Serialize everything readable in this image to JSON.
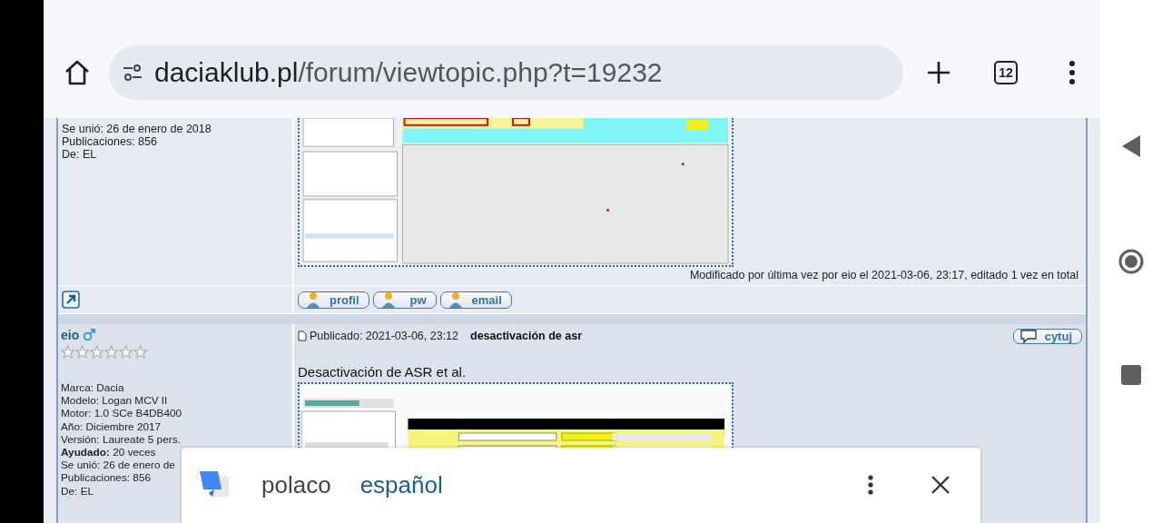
{
  "browser": {
    "url_host": "daciaklub.pl",
    "url_path": "/forum/viewtopic.php?t=19232",
    "tab_count": "12"
  },
  "posts": [
    {
      "profile_lines": [
        "Se unió: 26 de enero de 2018",
        "Publicaciones: 856",
        "De: EL"
      ],
      "edit_note": "Modificado por última vez por eio el 2021-03-06, 23:17, editado 1 vez en total",
      "buttons": [
        "profil",
        "pw",
        "email"
      ]
    },
    {
      "author": "eio",
      "stars": 0,
      "published": "Publicado: 2021-03-06, 23:12",
      "subject": "desactivación de asr",
      "quote_button": "cytuj",
      "profile_lines": [
        "Marca: Dacia",
        "Modelo: Logan MCV II",
        "Motor: 1.0 SCe B4DB400",
        "Año: Diciembre 2017",
        "Versión: Laureate 5 pers.",
        "**Ayudado:** 20 veces",
        "Se unió: 26 de enero de",
        "Publicaciones: 856",
        "De: EL"
      ],
      "body": "Desactivación de ASR et al."
    }
  ],
  "translate_bar": {
    "languages": [
      {
        "label": "polaco",
        "selected": false
      },
      {
        "label": "español",
        "selected": true
      }
    ]
  }
}
